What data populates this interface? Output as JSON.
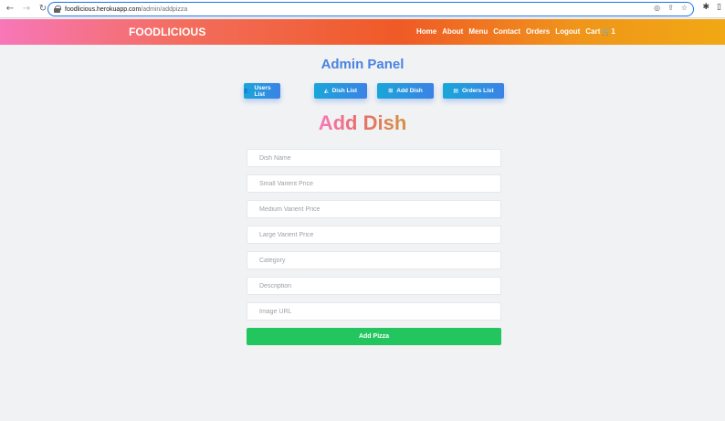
{
  "browser": {
    "url_host": "foodlicious.herokuapp.com",
    "url_path": "/admin/addpizza"
  },
  "navbar": {
    "brand": "FOODLICIOUS",
    "links": [
      "Home",
      "About",
      "Menu",
      "Contact",
      "Orders",
      "Logout"
    ],
    "cart_label": "Cart",
    "cart_count": "1"
  },
  "admin": {
    "title": "Admin Panel",
    "buttons": [
      {
        "label": "Users List",
        "icon": "users-icon"
      },
      {
        "label": "Dish List",
        "icon": "pizza-slice-icon"
      },
      {
        "label": "Add Dish",
        "icon": "plus-square-icon"
      },
      {
        "label": "Orders List",
        "icon": "clipboard-icon"
      }
    ]
  },
  "form": {
    "title": "Add Dish",
    "fields": [
      {
        "placeholder": "Dish Name",
        "value": ""
      },
      {
        "placeholder": "Small Varient Price",
        "value": ""
      },
      {
        "placeholder": "Medium Varient Price",
        "value": ""
      },
      {
        "placeholder": "Large Varient Price",
        "value": ""
      },
      {
        "placeholder": "Category",
        "value": ""
      },
      {
        "placeholder": "Description",
        "value": ""
      },
      {
        "placeholder": "Image URL",
        "value": ""
      }
    ],
    "submit_label": "Add Pizza"
  },
  "colors": {
    "accent_blue": "#4a83e0",
    "submit_green": "#22c55e",
    "navbar_gradient": [
      "#f777b9",
      "#ef5a26",
      "#f1a814"
    ]
  }
}
